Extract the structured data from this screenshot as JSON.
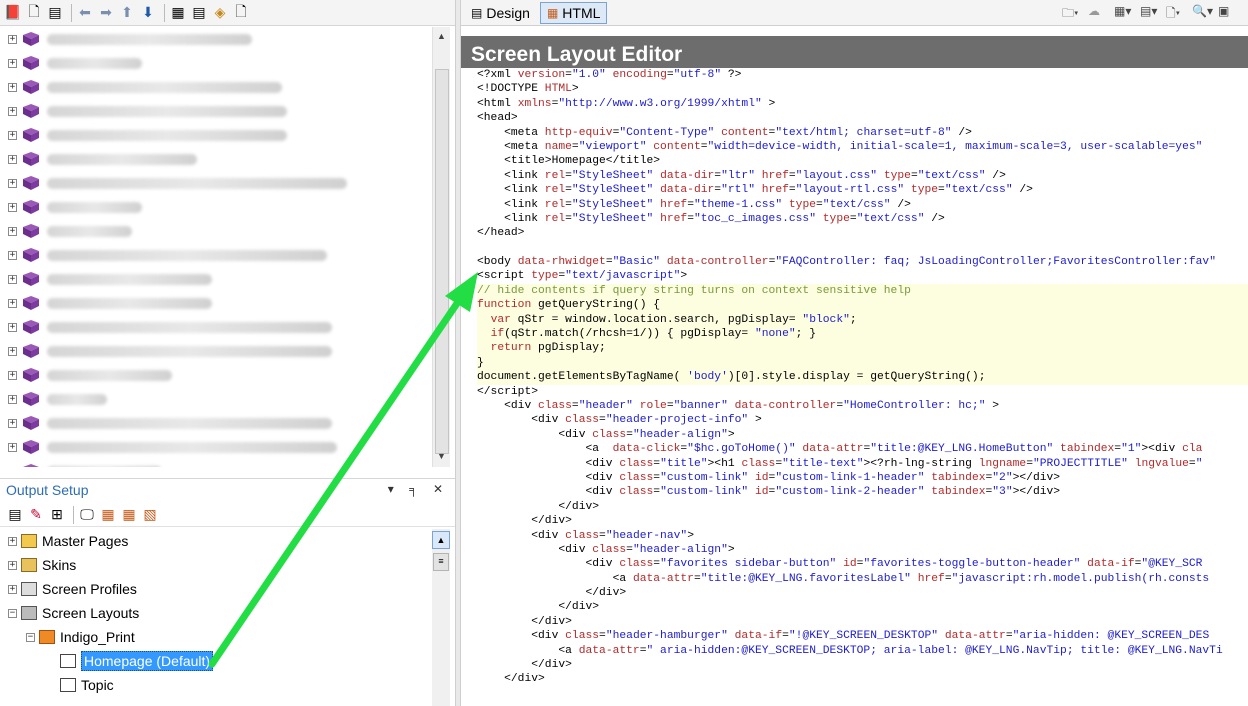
{
  "left_toolbar": {
    "icons": [
      "help-book-icon",
      "new-page-icon",
      "properties-icon",
      "back-arrow-icon",
      "forward-arrow-icon",
      "up-arrow-icon",
      "down-arrow-icon",
      "new-book-icon",
      "toc-icon",
      "diamond-icon",
      "document-icon"
    ]
  },
  "toc_tree": {
    "rows": 24
  },
  "output_setup": {
    "title": "Output Setup",
    "controls": "▾ ╕ ✕"
  },
  "bottom_tree": {
    "items": [
      {
        "label": "Master Pages",
        "icon": "master-pages-icon"
      },
      {
        "label": "Skins",
        "icon": "skins-icon"
      },
      {
        "label": "Screen Profiles",
        "icon": "screen-profiles-icon"
      },
      {
        "label": "Screen Layouts",
        "icon": "screen-layouts-icon"
      },
      {
        "label": "Indigo_Print",
        "icon": "layout-folder-icon"
      },
      {
        "label": "Homepage (Default)",
        "icon": "page-layout-icon"
      },
      {
        "label": "Topic",
        "icon": "topic-icon"
      }
    ]
  },
  "editor": {
    "tabs": [
      {
        "label": "Design"
      },
      {
        "label": "HTML"
      }
    ],
    "title": "Screen Layout Editor"
  },
  "colors": {
    "accent": "#2e6db3",
    "header_bg": "#6d6d6d",
    "arrow": "#22dd44",
    "selection": "#3399ff"
  }
}
